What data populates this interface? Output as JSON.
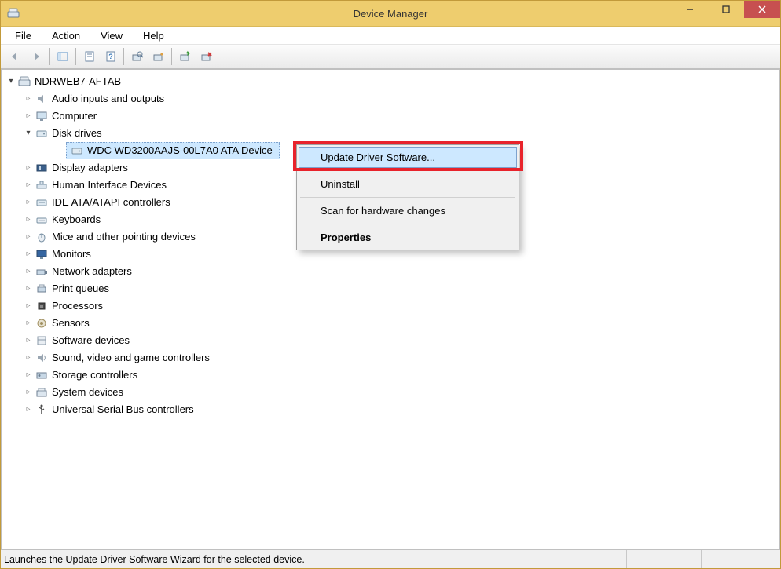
{
  "window": {
    "title": "Device Manager"
  },
  "menu": {
    "file": "File",
    "action": "Action",
    "view": "View",
    "help": "Help"
  },
  "tree": {
    "root": "NDRWEB7-AFTAB",
    "audio": "Audio inputs and outputs",
    "computer": "Computer",
    "diskdrives": "Disk drives",
    "disk_child": "WDC WD3200AAJS-00L7A0 ATA Device",
    "displayadapters": "Display adapters",
    "hid": "Human Interface Devices",
    "ide": "IDE ATA/ATAPI controllers",
    "keyboards": "Keyboards",
    "mice": "Mice and other pointing devices",
    "monitors": "Monitors",
    "netadapters": "Network adapters",
    "printq": "Print queues",
    "processors": "Processors",
    "sensors": "Sensors",
    "software": "Software devices",
    "sound": "Sound, video and game controllers",
    "storage": "Storage controllers",
    "system": "System devices",
    "usb": "Universal Serial Bus controllers"
  },
  "context_menu": {
    "update": "Update Driver Software...",
    "uninstall": "Uninstall",
    "scan": "Scan for hardware changes",
    "properties": "Properties"
  },
  "statusbar": {
    "text": "Launches the Update Driver Software Wizard for the selected device."
  }
}
